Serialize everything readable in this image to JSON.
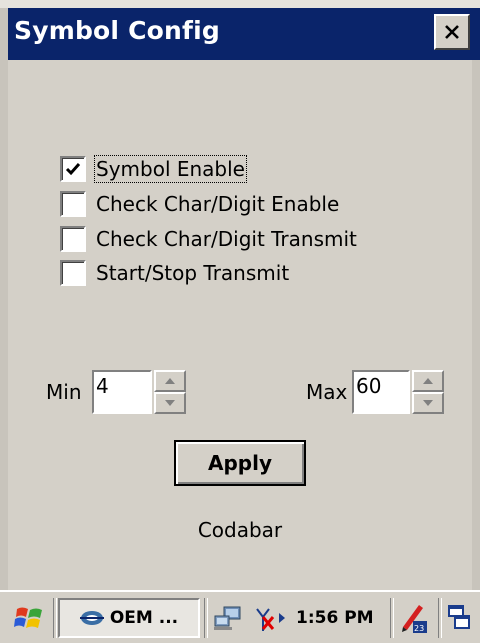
{
  "window": {
    "title": "Symbol Config",
    "close_icon": "close-icon"
  },
  "options": [
    {
      "label": "Symbol Enable",
      "checked": true,
      "focused": true
    },
    {
      "label": "Check Char/Digit Enable",
      "checked": false
    },
    {
      "label": "Check Char/Digit Transmit",
      "checked": false
    },
    {
      "label": "Start/Stop Transmit",
      "checked": false
    }
  ],
  "min": {
    "label": "Min",
    "value": "4"
  },
  "max": {
    "label": "Max",
    "value": "60"
  },
  "apply_label": "Apply",
  "symbology": "Codabar",
  "taskbar": {
    "task_label": "OEM ...",
    "clock": "1:56 PM",
    "icons": [
      "start-icon",
      "task-app-icon",
      "network-icon",
      "signal-icon",
      "input-panel-icon",
      "desktop-icon"
    ]
  },
  "colors": {
    "titlebar": "#0a246a",
    "face": "#d4d0c8"
  }
}
